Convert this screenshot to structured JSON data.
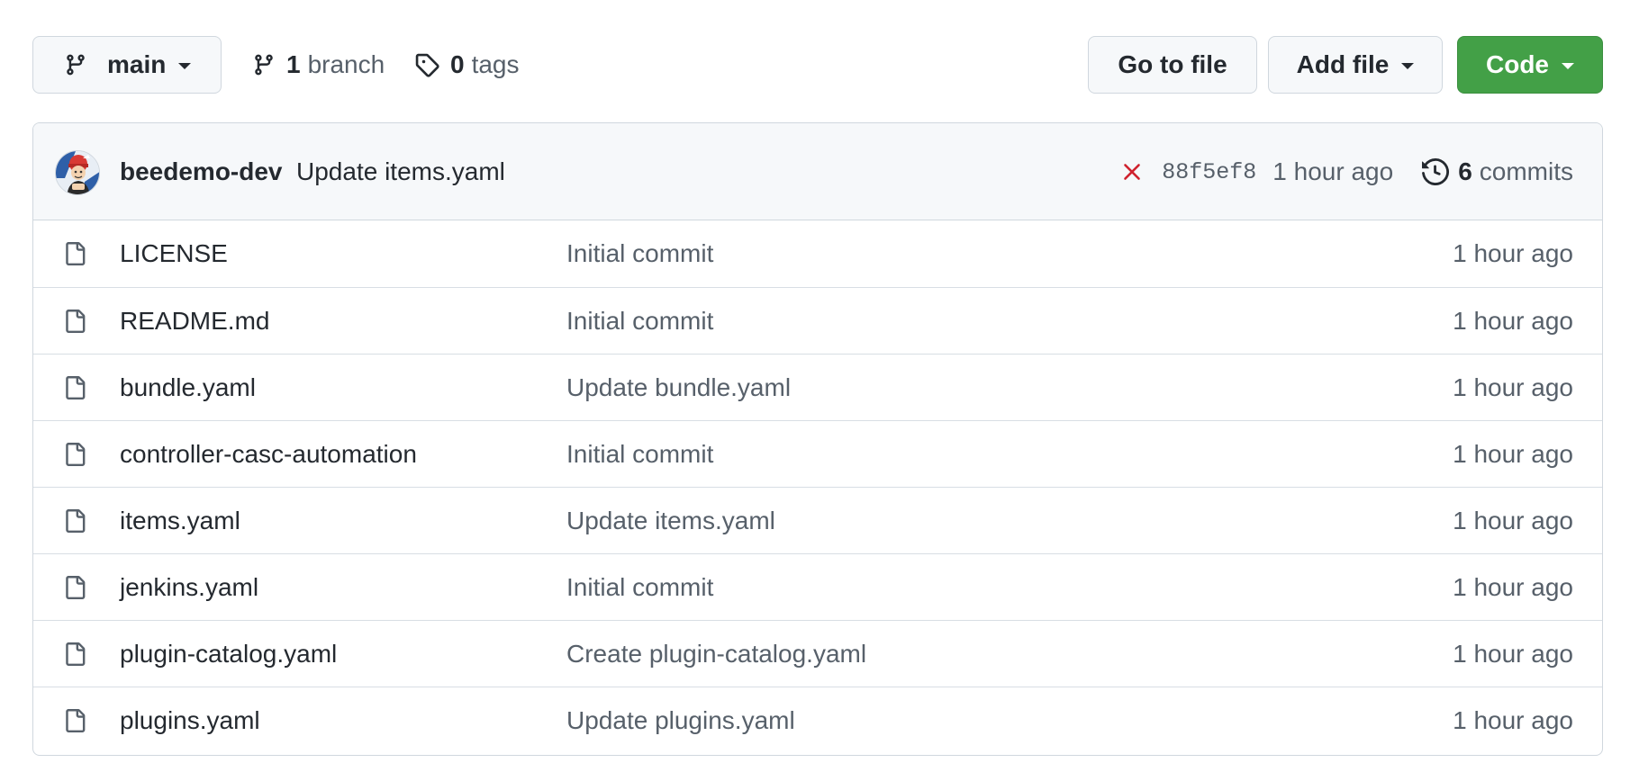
{
  "toolbar": {
    "branch_label": "main",
    "branches_count": "1",
    "branches_label": "branch",
    "tags_count": "0",
    "tags_label": "tags",
    "goto_label": "Go to file",
    "addfile_label": "Add file",
    "code_label": "Code"
  },
  "latest_commit": {
    "author": "beedemo-dev",
    "message": "Update items.yaml",
    "sha": "88f5ef8",
    "time": "1 hour ago",
    "commits_count": "6",
    "commits_label": "commits",
    "status": "failure"
  },
  "files": [
    {
      "name": "LICENSE",
      "message": "Initial commit",
      "time": "1 hour ago"
    },
    {
      "name": "README.md",
      "message": "Initial commit",
      "time": "1 hour ago"
    },
    {
      "name": "bundle.yaml",
      "message": "Update bundle.yaml",
      "time": "1 hour ago"
    },
    {
      "name": "controller-casc-automation",
      "message": "Initial commit",
      "time": "1 hour ago"
    },
    {
      "name": "items.yaml",
      "message": "Update items.yaml",
      "time": "1 hour ago"
    },
    {
      "name": "jenkins.yaml",
      "message": "Initial commit",
      "time": "1 hour ago"
    },
    {
      "name": "plugin-catalog.yaml",
      "message": "Create plugin-catalog.yaml",
      "time": "1 hour ago"
    },
    {
      "name": "plugins.yaml",
      "message": "Update plugins.yaml",
      "time": "1 hour ago"
    }
  ],
  "icons": {
    "branch": "git-branch-icon",
    "tag": "tag-icon",
    "history": "history-icon",
    "status": "x-icon",
    "file": "file-icon"
  },
  "colors": {
    "accent_green": "#43a047",
    "status_red": "#cf222e",
    "muted_text": "#57606a",
    "border": "#d0d7de"
  }
}
